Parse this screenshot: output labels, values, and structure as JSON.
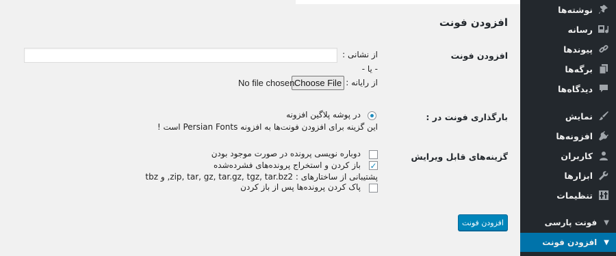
{
  "page": {
    "title": "افزودن فونت"
  },
  "sidebar": {
    "items": [
      {
        "label": "نوشته‌ها",
        "icon": "pushpin-icon"
      },
      {
        "label": "رسانه",
        "icon": "media-icon"
      },
      {
        "label": "پیوندها",
        "icon": "link-icon"
      },
      {
        "label": "برگه‌ها",
        "icon": "pages-icon"
      },
      {
        "label": "دیدگاه‌ها",
        "icon": "comment-icon"
      },
      {
        "label": "نمایش",
        "icon": "brush-icon"
      },
      {
        "label": "افزونه‌ها",
        "icon": "plugin-icon"
      },
      {
        "label": "کاربران",
        "icon": "users-icon"
      },
      {
        "label": "ابزارها",
        "icon": "wrench-icon"
      },
      {
        "label": "تنظیمات",
        "icon": "settings-icon"
      }
    ],
    "sub_items": [
      {
        "label": "فونت پارسی",
        "icon": "chevron-icon"
      },
      {
        "label": "افزودن فونت",
        "icon": "chevron-icon",
        "active": true
      }
    ],
    "colors": {
      "background": "#23282d",
      "active": "#0073aa"
    }
  },
  "add_font": {
    "label": "افزودن فونت",
    "from_url_label": "از نشانی :",
    "url_value": "",
    "or_text": "- یا -",
    "from_computer_label": "از رایانه :",
    "choose_file_label": "Choose File",
    "no_file_text": "No file chosen"
  },
  "upload_location": {
    "label": "بارگذاری فونت در :",
    "option_label": "در پوشه پلاگین افزونه",
    "option_selected": true,
    "note": "این گزینه برای افزودن فونت‌ها به افزونه Persian Fonts است !"
  },
  "options": {
    "label": "گزینه‌های قابل ویرایش",
    "overwrite_label": "دوباره نویسی پرونده در صورت موجود بودن",
    "overwrite_checked": false,
    "extract_label": "باز کردن و استخراج پرونده‌های فشرده‌شده",
    "extract_checked": true,
    "formats_text": "پشتیبانی از ساختارهای : zip, tar, gz, tar.gz, tgz, tar.bz2, و tbz",
    "delete_label": "پاک کردن پرونده‌ها پس از باز کردن",
    "delete_checked": false
  },
  "submit": {
    "label": "افزودن فونت",
    "color": "#0085ba"
  }
}
